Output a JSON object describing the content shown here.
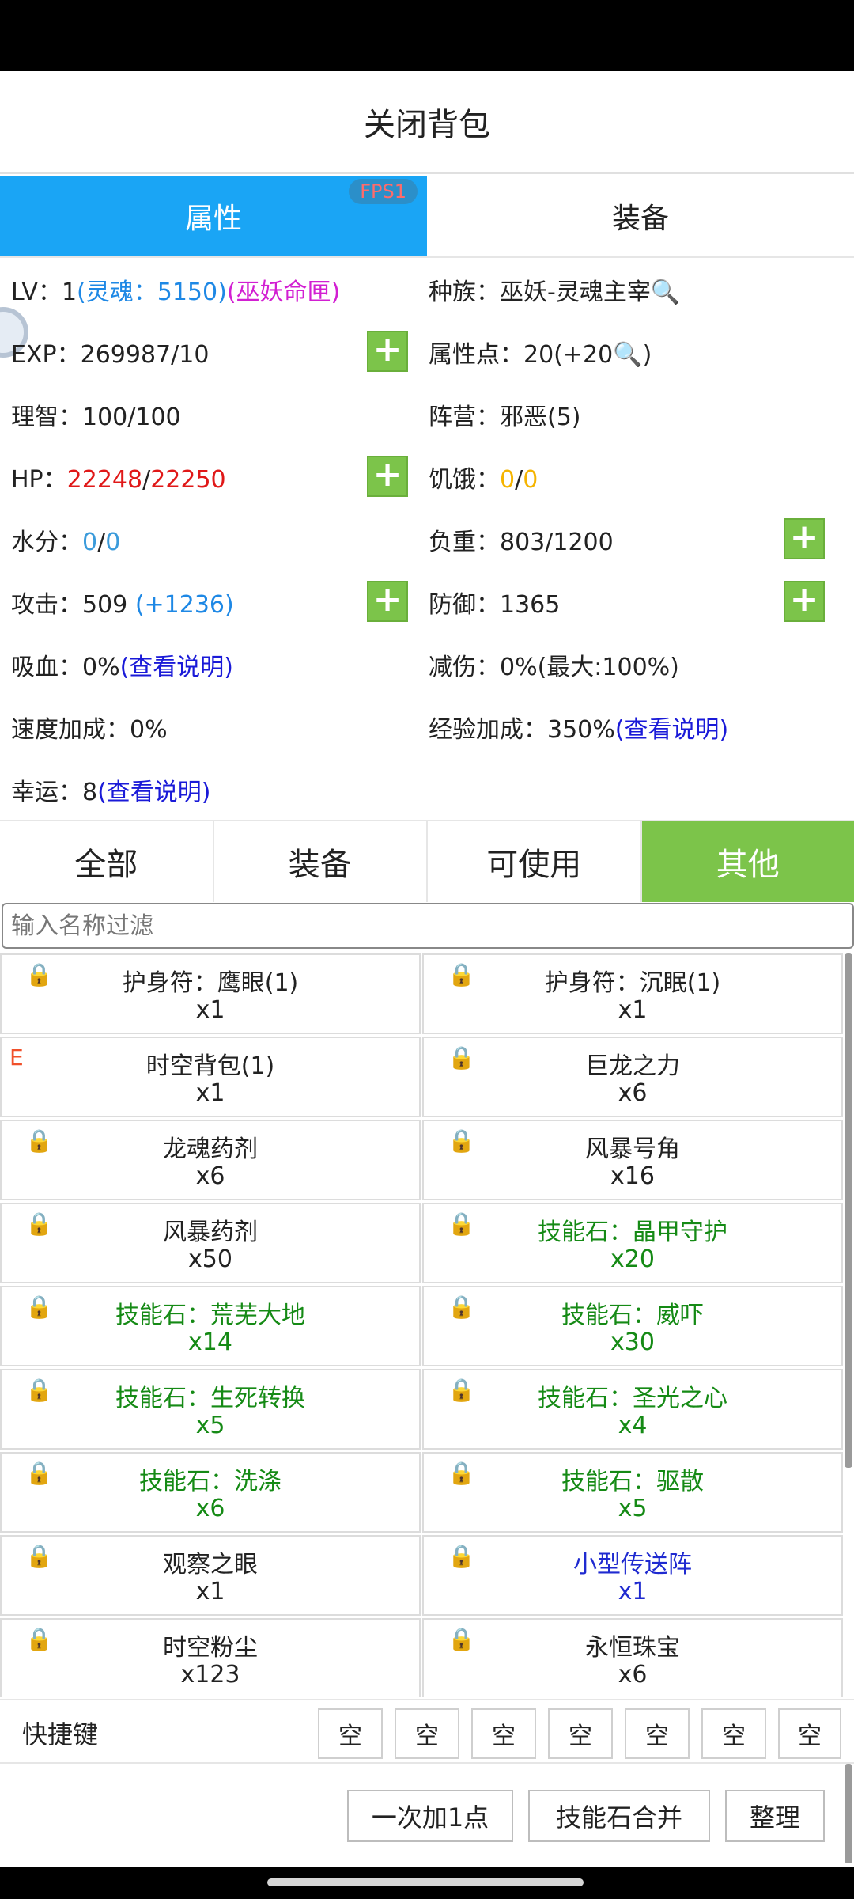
{
  "header": {
    "title": "关闭背包"
  },
  "main_tabs": [
    {
      "label": "属性",
      "active": true
    },
    {
      "label": "装备",
      "active": false
    }
  ],
  "fps_badge": "FPS1",
  "stats": {
    "lv_label": "LV：",
    "lv_value": "1",
    "lv_soul": "(灵魂：5150)",
    "lv_fate": "(巫妖命匣)",
    "race_label": "种族：",
    "race_value": "巫妖-灵魂主宰",
    "exp_label": "EXP：",
    "exp_value": "269987/10",
    "attr_points_label": "属性点：",
    "attr_points_value": "20(+20",
    "attr_points_suffix": ")",
    "sanity_label": "理智：",
    "sanity_value": "100/100",
    "camp_label": "阵营：",
    "camp_value": "邪恶(5)",
    "hp_label": "HP：",
    "hp_current": "22248",
    "hp_sep": "/",
    "hp_max": "22250",
    "hunger_label": "饥饿：",
    "hunger_current": "0",
    "hunger_sep": "/",
    "hunger_max": "0",
    "water_label": "水分：",
    "water_current": "0",
    "water_sep": "/",
    "water_max": "0",
    "load_label": "负重：",
    "load_value": "803/1200",
    "attack_label": "攻击：",
    "attack_value": "509",
    "attack_bonus": "(+1236)",
    "defense_label": "防御：",
    "defense_value": "1365",
    "lifesteal_label": "吸血：",
    "lifesteal_value": "0%",
    "lifesteal_link": "(查看说明)",
    "dmg_reduce_label": "减伤：",
    "dmg_reduce_value": "0%(最大:100%)",
    "speed_label": "速度加成：",
    "speed_value": "0%",
    "exp_bonus_label": "经验加成：",
    "exp_bonus_value": "350%",
    "exp_bonus_link": "(查看说明)",
    "luck_label": "幸运：",
    "luck_value": "8",
    "luck_link": "(查看说明)",
    "plus_label": "+"
  },
  "filter_tabs": [
    {
      "label": "全部",
      "active": false
    },
    {
      "label": "装备",
      "active": false
    },
    {
      "label": "可使用",
      "active": false
    },
    {
      "label": "其他",
      "active": true
    }
  ],
  "search": {
    "placeholder": "输入名称过滤",
    "value": ""
  },
  "items": [
    {
      "name": "护身符：鹰眼(1)",
      "qty": "x1",
      "color": "#222222",
      "icon": "lock-icon"
    },
    {
      "name": "护身符：沉眠(1)",
      "qty": "x1",
      "color": "#222222",
      "icon": "lock-icon"
    },
    {
      "name": "时空背包(1)",
      "qty": "x1",
      "color": "#222222",
      "icon": "E"
    },
    {
      "name": "巨龙之力",
      "qty": "x6",
      "color": "#222222",
      "icon": "lock-icon"
    },
    {
      "name": "龙魂药剂",
      "qty": "x6",
      "color": "#222222",
      "icon": "lock-icon"
    },
    {
      "name": "风暴号角",
      "qty": "x16",
      "color": "#222222",
      "icon": "lock-icon"
    },
    {
      "name": "风暴药剂",
      "qty": "x50",
      "color": "#222222",
      "icon": "lock-icon"
    },
    {
      "name": "技能石：晶甲守护",
      "qty": "x20",
      "color": "#158a15",
      "icon": "lock-icon"
    },
    {
      "name": "技能石：荒芜大地",
      "qty": "x14",
      "color": "#158a15",
      "icon": "lock-icon"
    },
    {
      "name": "技能石：威吓",
      "qty": "x30",
      "color": "#158a15",
      "icon": "lock-icon"
    },
    {
      "name": "技能石：生死转换",
      "qty": "x5",
      "color": "#158a15",
      "icon": "lock-icon"
    },
    {
      "name": "技能石：圣光之心",
      "qty": "x4",
      "color": "#158a15",
      "icon": "lock-icon"
    },
    {
      "name": "技能石：洗涤",
      "qty": "x6",
      "color": "#158a15",
      "icon": "lock-icon"
    },
    {
      "name": "技能石：驱散",
      "qty": "x5",
      "color": "#158a15",
      "icon": "lock-icon"
    },
    {
      "name": "观察之眼",
      "qty": "x1",
      "color": "#222222",
      "icon": "lock-icon"
    },
    {
      "name": "小型传送阵",
      "qty": "x1",
      "color": "#1f2ad0",
      "icon": "lock-icon"
    },
    {
      "name": "时空粉尘",
      "qty": "x123",
      "color": "#222222",
      "icon": "lock-icon"
    },
    {
      "name": "永恒珠宝",
      "qty": "x6",
      "color": "#222222",
      "icon": "lock-icon"
    }
  ],
  "shortcut": {
    "label": "快捷键",
    "slots": [
      "空",
      "空",
      "空",
      "空",
      "空",
      "空",
      "空"
    ]
  },
  "actions": {
    "add_one": "一次加1点",
    "merge_stones": "技能石合并",
    "sort": "整理"
  },
  "colors": {
    "tab_active": "#1aa5f5",
    "filter_active": "#7cc44a",
    "plus_button": "#7cc44a"
  }
}
